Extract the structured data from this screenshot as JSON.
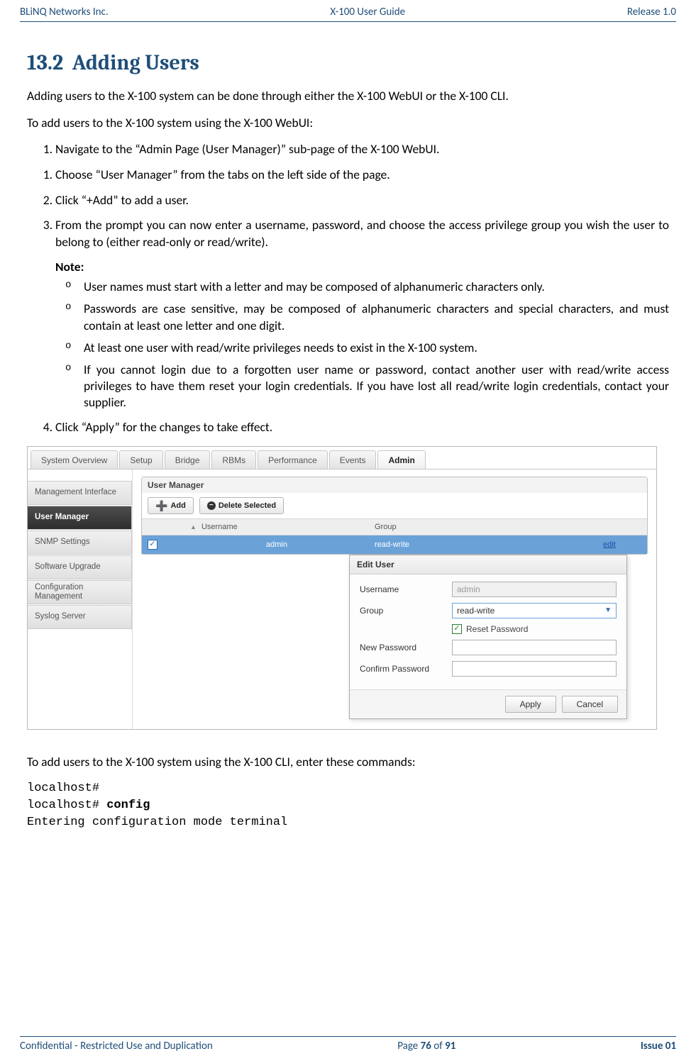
{
  "header": {
    "left": "BLiNQ Networks Inc.",
    "center": "X-100 User Guide",
    "right": "Release 1.0"
  },
  "section": {
    "number": "13.2",
    "title": "Adding Users"
  },
  "paras": {
    "intro": "Adding users to the X-100 system can be done through either the X-100 WebUI or the X-100 CLI.",
    "toweb": "To add users to the X-100 system using the X-100 WebUI:",
    "tocli": "To add users to the X-100 system using the X-100 CLI, enter these commands:"
  },
  "steps1": [
    "Navigate to the “Admin Page (User Manager)” sub-page of the X-100 WebUI.",
    "Choose “User Manager” from the tabs on the left side of the page.",
    "Click “+Add” to add a user.",
    "From the prompt you can now enter a username, password, and choose the access privilege group you wish the user to belong to (either read-only or read/write)."
  ],
  "note_label": "Note:",
  "notes": [
    "User names must start with a letter and may be composed of alphanumeric characters only.",
    "Passwords are case sensitive, may be composed of alphanumeric characters and special characters, and must contain at least one letter and one digit.",
    "At least one user with read/write privileges needs to exist in the X-100 system.",
    "If you cannot login due to a forgotten user name or password, contact another user with read/write access privileges to have them reset your login credentials. If you have lost all read/write login credentials, contact your supplier."
  ],
  "steps2": [
    "Click “Apply” for the changes to take effect."
  ],
  "ui": {
    "top_tabs": [
      "System Overview",
      "Setup",
      "Bridge",
      "RBMs",
      "Performance",
      "Events",
      "Admin"
    ],
    "active_tab": "Admin",
    "side": [
      "Management Interface",
      "User Manager",
      "SNMP Settings",
      "Software Upgrade",
      "Configuration Management",
      "Syslog Server"
    ],
    "side_active": "User Manager",
    "panel_title": "User Manager",
    "btn_add": "Add",
    "btn_del": "Delete Selected",
    "th_sort_icon": "▲",
    "th_user": "Username",
    "th_group": "Group",
    "row": {
      "username": "admin",
      "group": "read-write",
      "edit": "edit"
    },
    "edit": {
      "title": "Edit User",
      "l_user": "Username",
      "v_user": "admin",
      "l_group": "Group",
      "v_group": "read-write",
      "l_reset": "Reset Password",
      "l_new": "New Password",
      "l_confirm": "Confirm Password",
      "btn_apply": "Apply",
      "btn_cancel": "Cancel"
    }
  },
  "cli": {
    "l1": "localhost#",
    "l2a": "localhost# ",
    "l2b": "config",
    "l3": "Entering configuration mode terminal"
  },
  "footer": {
    "left": "Confidential - Restricted Use and Duplication",
    "page_pre": "Page ",
    "page_num": "76",
    "page_mid": " of ",
    "page_total": "91",
    "right": "Issue 01"
  }
}
